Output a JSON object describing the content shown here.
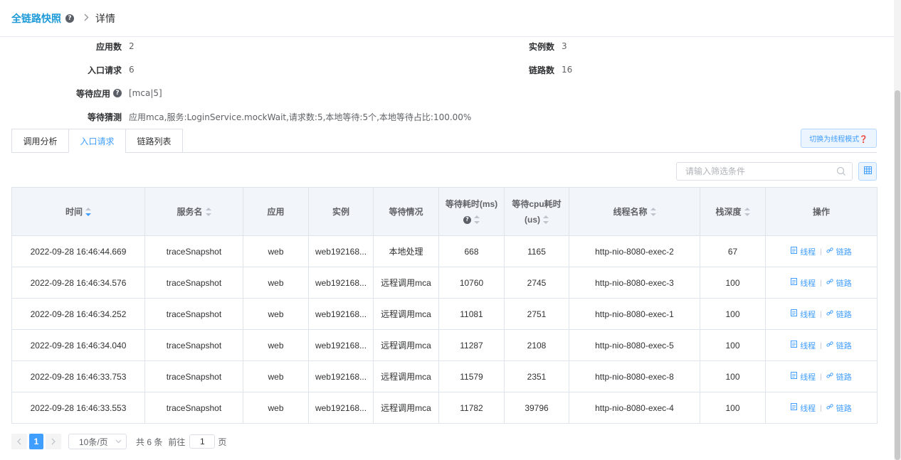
{
  "breadcrumb": {
    "root": "全链路快照",
    "help": "?",
    "separator": ">",
    "current": "详情"
  },
  "summary": {
    "app_count_label": "应用数",
    "app_count": "2",
    "instance_count_label": "实例数",
    "instance_count": "3",
    "entry_requests_label": "入口请求",
    "entry_requests": "6",
    "trace_count_label": "链路数",
    "trace_count": "16",
    "waiting_apps_label": "等待应用",
    "waiting_apps": "[mca|5]",
    "wait_guess_label": "等待猜测",
    "wait_guess": "应用mca,服务:LoginService.mockWait,请求数:5,本地等待:5个,本地等待占比:100.00%"
  },
  "tabs": [
    {
      "label": "调用分析"
    },
    {
      "label": "入口请求"
    },
    {
      "label": "链路列表"
    }
  ],
  "switch_button": "切换为线程模式❓",
  "search": {
    "placeholder": "请输入筛选条件"
  },
  "table": {
    "headers": {
      "time": "时间",
      "service": "服务名",
      "app": "应用",
      "instance": "实例",
      "wait": "等待情况",
      "wait_ms_1": "等待耗时(ms)",
      "wait_cpu_1": "等待cpu耗时",
      "wait_cpu_2": "(us)",
      "thread": "线程名称",
      "depth": "栈深度",
      "ops": "操作"
    },
    "rows": [
      {
        "time": "2022-09-28 16:46:44.669",
        "service": "traceSnapshot",
        "app": "web",
        "instance": "web192168...",
        "wait": "本地处理",
        "wait_ms": "668",
        "cpu_us": "1165",
        "thread": "http-nio-8080-exec-2",
        "depth": "67",
        "op1": "线程",
        "op2": "链路"
      },
      {
        "time": "2022-09-28 16:46:34.576",
        "service": "traceSnapshot",
        "app": "web",
        "instance": "web192168...",
        "wait": "远程调用mca",
        "wait_ms": "10760",
        "cpu_us": "2745",
        "thread": "http-nio-8080-exec-3",
        "depth": "100",
        "op1": "线程",
        "op2": "链路"
      },
      {
        "time": "2022-09-28 16:46:34.252",
        "service": "traceSnapshot",
        "app": "web",
        "instance": "web192168...",
        "wait": "远程调用mca",
        "wait_ms": "11081",
        "cpu_us": "2751",
        "thread": "http-nio-8080-exec-1",
        "depth": "100",
        "op1": "线程",
        "op2": "链路"
      },
      {
        "time": "2022-09-28 16:46:34.040",
        "service": "traceSnapshot",
        "app": "web",
        "instance": "web192168...",
        "wait": "远程调用mca",
        "wait_ms": "11287",
        "cpu_us": "2108",
        "thread": "http-nio-8080-exec-5",
        "depth": "100",
        "op1": "线程",
        "op2": "链路"
      },
      {
        "time": "2022-09-28 16:46:33.753",
        "service": "traceSnapshot",
        "app": "web",
        "instance": "web192168...",
        "wait": "远程调用mca",
        "wait_ms": "11579",
        "cpu_us": "2351",
        "thread": "http-nio-8080-exec-8",
        "depth": "100",
        "op1": "线程",
        "op2": "链路"
      },
      {
        "time": "2022-09-28 16:46:33.553",
        "service": "traceSnapshot",
        "app": "web",
        "instance": "web192168...",
        "wait": "远程调用mca",
        "wait_ms": "11782",
        "cpu_us": "39796",
        "thread": "http-nio-8080-exec-4",
        "depth": "100",
        "op1": "线程",
        "op2": "链路"
      }
    ]
  },
  "pager": {
    "current_page": "1",
    "page_size": "10条/页",
    "total": "共 6 条",
    "goto_label": "前往",
    "goto_value": "1",
    "page_unit": "页"
  },
  "colors": {
    "accent": "#409eff",
    "breadcrumb": "#1f9bd8",
    "header_bg": "#f2f6fb"
  }
}
